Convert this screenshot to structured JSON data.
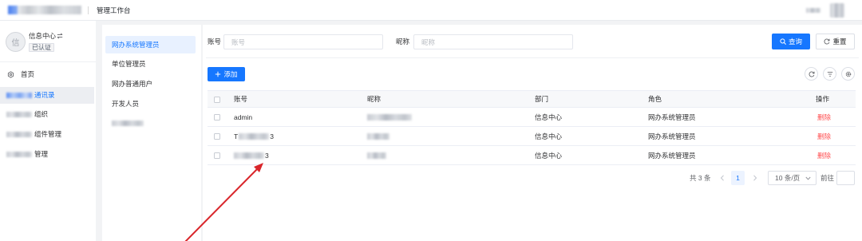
{
  "header": {
    "title": "管理工作台"
  },
  "sidebar": {
    "profile": {
      "avatar_text": "信",
      "name": "信息中心",
      "switch_icon": "switch-icon",
      "badge": "已认证"
    },
    "items": [
      {
        "label": "首页",
        "icon": "home-icon",
        "active": false
      },
      {
        "label": "通讯录",
        "active": true
      },
      {
        "label": "组织",
        "active": false
      },
      {
        "label": "组件管理",
        "active": false
      },
      {
        "label": "管理",
        "active": false
      }
    ]
  },
  "roles": {
    "items": [
      {
        "label": "网办系统管理员",
        "active": true
      },
      {
        "label": "单位管理员",
        "active": false
      },
      {
        "label": "网办普通用户",
        "active": false
      },
      {
        "label": "开发人员",
        "active": false
      }
    ]
  },
  "search": {
    "account_label": "账号",
    "account_placeholder": "账号",
    "account_value": "",
    "nickname_label": "昵称",
    "nickname_placeholder": "昵称",
    "nickname_value": "",
    "query_button": "查询",
    "query_icon": "search-icon",
    "reset_button": "重置",
    "reset_icon": "refresh-icon"
  },
  "toolbar": {
    "add_button": "添加",
    "add_icon": "plus-icon",
    "icons": [
      "refresh-icon",
      "sort-icon",
      "settings-icon"
    ]
  },
  "table": {
    "columns": [
      "账号",
      "昵称",
      "部门",
      "角色",
      "操作"
    ],
    "rows": [
      {
        "account": "admin",
        "department": "信息中心",
        "role": "网办系统管理员",
        "action": "删除"
      },
      {
        "account_prefix": "T",
        "account_suffix": "3",
        "department": "信息中心",
        "role": "网办系统管理员",
        "action": "删除"
      },
      {
        "account_suffix": "3",
        "department": "信息中心",
        "role": "网办系统管理员",
        "action": "删除"
      }
    ]
  },
  "pagination": {
    "total": "共 3 条",
    "current_page": "1",
    "page_size": "10 条/页",
    "goto_label": "前往",
    "goto_value": ""
  },
  "colors": {
    "primary": "#1677ff",
    "primary_light": "#e8f1ff",
    "danger": "#ff4d4f",
    "annotation_arrow": "#d9252a"
  }
}
